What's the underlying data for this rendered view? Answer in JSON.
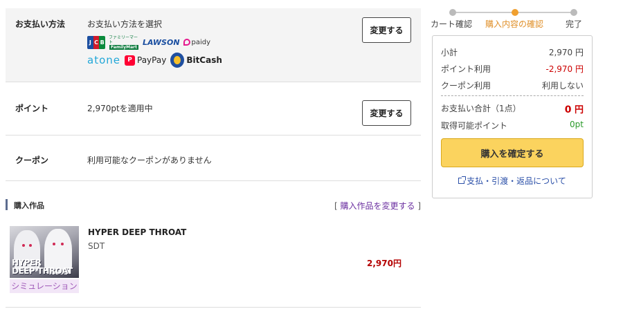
{
  "payment": {
    "label": "お支払い方法",
    "value": "お支払い方法を選択",
    "change_label": "変更する",
    "methods": {
      "jcb": "JCB",
      "familymart_top": "ファミリーマート",
      "familymart": "FamilyMart",
      "lawson": "LAWSON",
      "paidy": "paidy",
      "atone": "atone",
      "paypay": "PayPay",
      "bitcash": "BitCash"
    }
  },
  "points": {
    "label": "ポイント",
    "value": "2,970ptを適用中",
    "change_label": "変更する"
  },
  "coupon": {
    "label": "クーポン",
    "value": "利用可能なクーポンがありません"
  },
  "works": {
    "heading": "購入作品",
    "change_link": "購入作品を変更する",
    "bracket_open": "[",
    "bracket_close": "]",
    "items": [
      {
        "title": "HYPER DEEP THROAT",
        "circle": "SDT",
        "price": "2,970円",
        "thumb_text_1": "HYPER",
        "thumb_text_2": "DEEP THROAT",
        "tag": "シミュレーション"
      }
    ]
  },
  "steps": [
    {
      "label": "カート確認",
      "active": false
    },
    {
      "label": "購入内容の確認",
      "active": true
    },
    {
      "label": "完了",
      "active": false
    }
  ],
  "summary": {
    "subtotal_label": "小計",
    "subtotal_value": "2,970 円",
    "points_label": "ポイント利用",
    "points_value": "-2,970 円",
    "coupon_label": "クーポン利用",
    "coupon_value": "利用しない",
    "total_label": "お支払い合計（1点）",
    "total_amount": "0",
    "total_unit": "円",
    "earn_label": "取得可能ポイント",
    "earn_value": "0pt",
    "confirm_label": "購入を確定する",
    "help_link": "支払・引渡・返品について"
  },
  "colors": {
    "accent_orange": "#f0a030",
    "price_red": "#c00000",
    "confirm_yellow": "#fbd35e",
    "link_blue": "#2a4fa8",
    "tag_purple": "#a05ab8"
  }
}
